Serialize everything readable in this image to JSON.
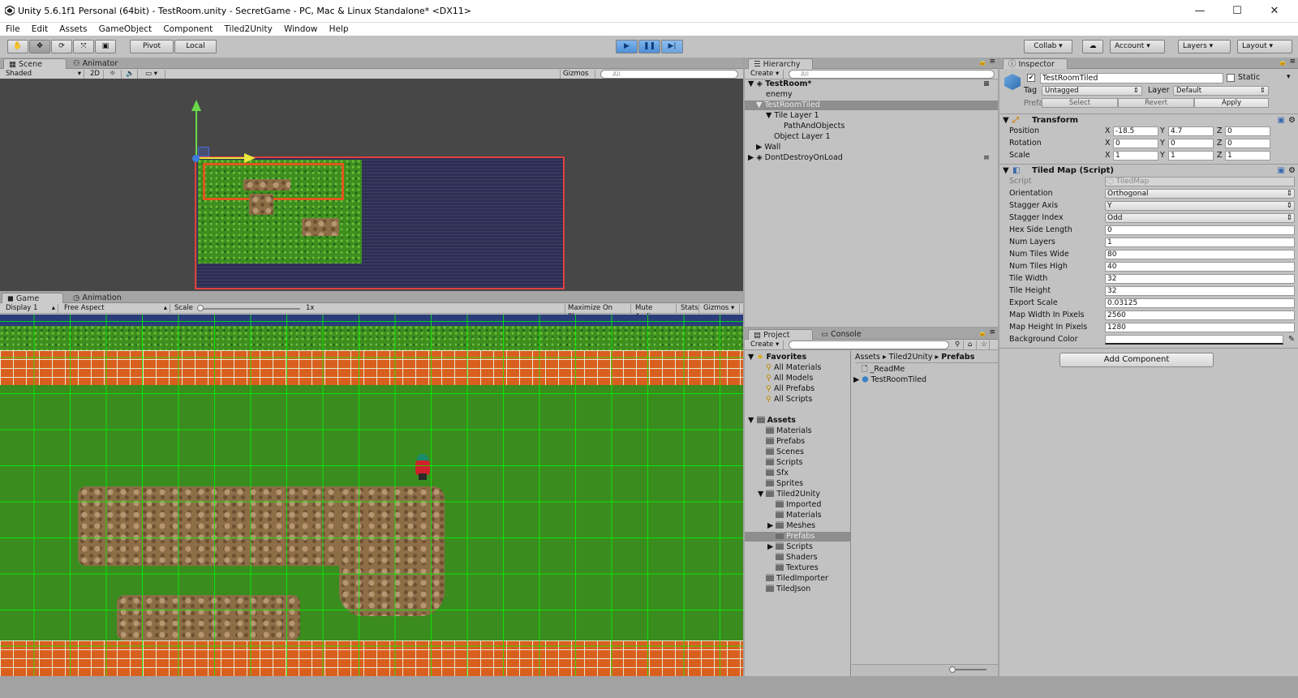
{
  "window": {
    "title": "Unity 5.6.1f1 Personal (64bit) - TestRoom.unity - SecretGame - PC, Mac & Linux Standalone* <DX11>",
    "minimize": "—",
    "maximize": "☐",
    "close": "✕"
  },
  "menu": [
    "File",
    "Edit",
    "Assets",
    "GameObject",
    "Component",
    "Tiled2Unity",
    "Window",
    "Help"
  ],
  "toolbar": {
    "pivot": "Pivot",
    "local": "Local",
    "collab": "Collab",
    "account": "Account",
    "layers": "Layers",
    "layout": "Layout"
  },
  "scene": {
    "tab": "Scene",
    "tab2": "Animator",
    "shading": "Shaded",
    "mode2d": "2D",
    "gizmos": "Gizmos",
    "search": "All"
  },
  "game": {
    "tab": "Game",
    "tab2": "Animation",
    "display": "Display 1",
    "aspect": "Free Aspect",
    "scale_label": "Scale",
    "scale_value": "1x",
    "maximize": "Maximize On Play",
    "mute": "Mute Audio",
    "stats": "Stats",
    "gizmos": "Gizmos"
  },
  "hierarchy": {
    "tab": "Hierarchy",
    "create": "Create",
    "search": "All",
    "items": [
      {
        "label": "TestRoom*"
      },
      {
        "label": "enemy"
      },
      {
        "label": "TestRoomTiled"
      },
      {
        "label": "Tile Layer 1"
      },
      {
        "label": "PathAndObjects"
      },
      {
        "label": "Object Layer 1"
      },
      {
        "label": "Wall"
      },
      {
        "label": "DontDestroyOnLoad"
      }
    ]
  },
  "project": {
    "tab": "Project",
    "tab2": "Console",
    "create": "Create",
    "favorites_label": "Favorites",
    "favorites": [
      "All Materials",
      "All Models",
      "All Prefabs",
      "All Scripts"
    ],
    "assets_label": "Assets",
    "folders": [
      "Materials",
      "Prefabs",
      "Scenes",
      "Scripts",
      "Sfx",
      "Sprites",
      "Tiled2Unity",
      "Imported",
      "Materials",
      "Meshes",
      "Prefabs",
      "Scripts",
      "Shaders",
      "Textures",
      "TiledImporter",
      "TiledJson"
    ],
    "breadcrumb": {
      "a": "Assets",
      "b": "Tiled2Unity",
      "c": "Prefabs",
      "sep": "▸"
    },
    "files": [
      "_ReadMe",
      "TestRoomTiled"
    ]
  },
  "inspector": {
    "tab": "Inspector",
    "name": "TestRoomTiled",
    "static": "Static",
    "tag_label": "Tag",
    "tag": "Untagged",
    "layer_label": "Layer",
    "layer": "Default",
    "prefab_label": "Prefab",
    "select": "Select",
    "revert": "Revert",
    "apply": "Apply",
    "transform": {
      "title": "Transform",
      "position": "Position",
      "rotation": "Rotation",
      "scale": "Scale",
      "pos": {
        "x": "-18.5",
        "y": "4.7",
        "z": "0"
      },
      "rot": {
        "x": "0",
        "y": "0",
        "z": "0"
      },
      "scl": {
        "x": "1",
        "y": "1",
        "z": "1"
      },
      "xl": "X",
      "yl": "Y",
      "zl": "Z"
    },
    "tiled": {
      "title": "Tiled Map (Script)",
      "rows": [
        {
          "label": "Script",
          "value": "TiledMap"
        },
        {
          "label": "Orientation",
          "value": "Orthogonal"
        },
        {
          "label": "Stagger Axis",
          "value": "Y"
        },
        {
          "label": "Stagger Index",
          "value": "Odd"
        },
        {
          "label": "Hex Side Length",
          "value": "0"
        },
        {
          "label": "Num Layers",
          "value": "1"
        },
        {
          "label": "Num Tiles Wide",
          "value": "80"
        },
        {
          "label": "Num Tiles High",
          "value": "40"
        },
        {
          "label": "Tile Width",
          "value": "32"
        },
        {
          "label": "Tile Height",
          "value": "32"
        },
        {
          "label": "Export Scale",
          "value": "0.03125"
        },
        {
          "label": "Map Width In Pixels",
          "value": "2560"
        },
        {
          "label": "Map Height In Pixels",
          "value": "1280"
        },
        {
          "label": "Background Color",
          "value": ""
        }
      ]
    },
    "add_component": "Add Component"
  }
}
